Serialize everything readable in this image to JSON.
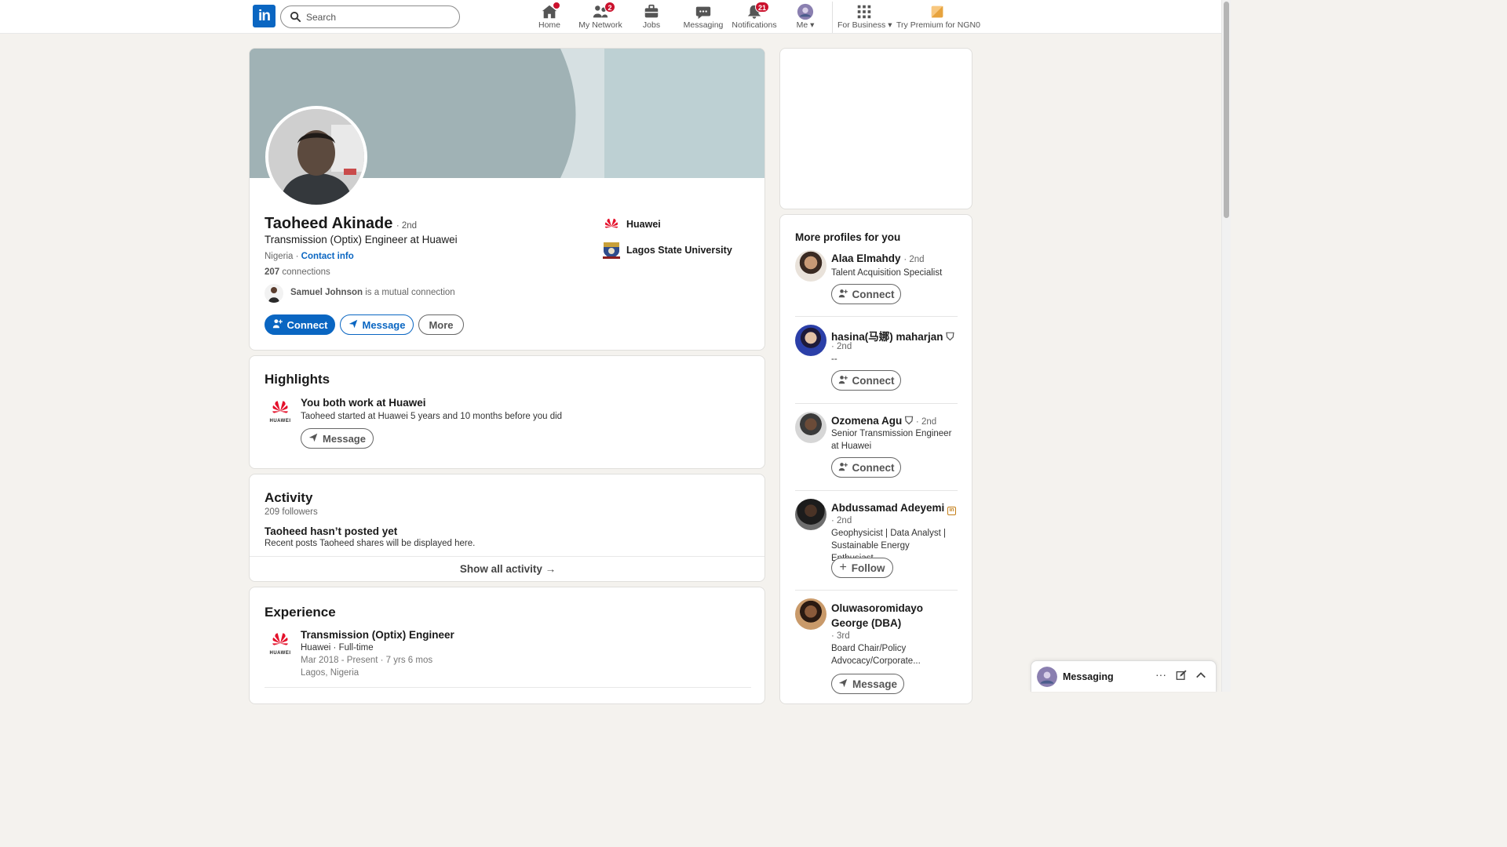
{
  "nav": {
    "search_placeholder": "Search",
    "items": [
      {
        "label": "Home",
        "icon": "home-icon",
        "badge": ""
      },
      {
        "label": "My Network",
        "icon": "network-icon",
        "badge": "2"
      },
      {
        "label": "Jobs",
        "icon": "briefcase-icon",
        "badge": ""
      },
      {
        "label": "Messaging",
        "icon": "messaging-icon",
        "badge": ""
      },
      {
        "label": "Notifications",
        "icon": "bell-icon",
        "badge": "21"
      },
      {
        "label": "Me",
        "icon": "avatar-icon",
        "badge": ""
      },
      {
        "label": "For Business",
        "icon": "grid-icon",
        "badge": ""
      },
      {
        "label": "Try Premium for NGN0",
        "icon": "premium-icon",
        "badge": ""
      }
    ]
  },
  "profile": {
    "name": "Taoheed Akinade",
    "degree": "· 2nd",
    "headline": "Transmission (Optix) Engineer at Huawei",
    "location": "Nigeria ·",
    "contact_info": "Contact info",
    "connections_count": "207",
    "connections_label": "connections",
    "mutual_name": "Samuel Johnson",
    "mutual_suffix": "is a mutual connection",
    "company": "Huawei",
    "school": "Lagos State University",
    "btn_connect": "Connect",
    "btn_message": "Message",
    "btn_more": "More"
  },
  "highlights": {
    "title": "Highlights",
    "heading": "You both work at Huawei",
    "text": "Taoheed started at Huawei 5 years and 10 months before you did",
    "btn_message": "Message",
    "logo_text": "HUAWEI"
  },
  "activity": {
    "title": "Activity",
    "followers": "209 followers",
    "empty_title": "Taoheed hasn’t posted yet",
    "empty_text": "Recent posts Taoheed shares will be displayed here.",
    "show_all": "Show all activity →"
  },
  "experience": {
    "title": "Experience",
    "items": [
      {
        "role": "Transmission (Optix) Engineer",
        "company": "Huawei · Full-time",
        "dates": "Mar 2018 - Present · 7 yrs 6 mos",
        "location": "Lagos, Nigeria",
        "logo_text": "HUAWEI"
      }
    ]
  },
  "right_rail": {
    "title": "More profiles for you",
    "profiles": [
      {
        "name": "Alaa Elmahdy",
        "degree": "· 2nd",
        "subtitle": "Talent Acquisition Specialist",
        "action": "Connect"
      },
      {
        "name": "hasina(马娜) maharjan",
        "degree": "· 2nd",
        "subtitle": "--",
        "action": "Connect"
      },
      {
        "name": "Ozomena Agu",
        "degree": "· 2nd",
        "subtitle": "Senior Transmission Engineer at Huawei",
        "action": "Connect"
      },
      {
        "name": "Abdussamad Adeyemi",
        "degree": "· 2nd",
        "subtitle": "Geophysicist | Data Analyst | Sustainable Energy Enthusiast...",
        "action": "Follow"
      },
      {
        "name": "Oluwasoromidayo George (DBA)",
        "degree": "· 3rd",
        "subtitle": "Board Chair/Policy Advocacy/Corporate...",
        "action": "Message"
      }
    ]
  },
  "messaging": {
    "label": "Messaging"
  },
  "colors": {
    "brand_blue": "#0a66c2",
    "badge_red": "#cb112d",
    "page_bg": "#f4f2ee"
  }
}
